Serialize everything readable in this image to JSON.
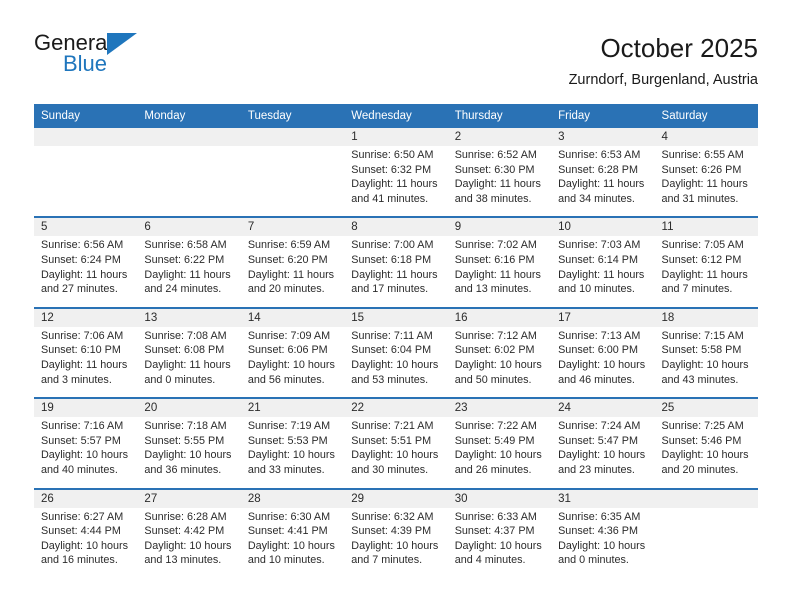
{
  "brand": {
    "name_top": "General",
    "name_bottom": "Blue",
    "accent_color": "#1f76bd"
  },
  "header": {
    "title": "October 2025",
    "subtitle": "Zurndorf, Burgenland, Austria"
  },
  "theme": {
    "header_bar_color": "#2a72b5",
    "daynum_band_color": "#f0f0f0",
    "text_color": "#2b2b2b"
  },
  "weekdays": [
    "Sunday",
    "Monday",
    "Tuesday",
    "Wednesday",
    "Thursday",
    "Friday",
    "Saturday"
  ],
  "weeks": [
    [
      {
        "day": "",
        "sunrise": "",
        "sunset": "",
        "daylight_a": "",
        "daylight_b": ""
      },
      {
        "day": "",
        "sunrise": "",
        "sunset": "",
        "daylight_a": "",
        "daylight_b": ""
      },
      {
        "day": "",
        "sunrise": "",
        "sunset": "",
        "daylight_a": "",
        "daylight_b": ""
      },
      {
        "day": "1",
        "sunrise": "Sunrise: 6:50 AM",
        "sunset": "Sunset: 6:32 PM",
        "daylight_a": "Daylight: 11 hours",
        "daylight_b": "and 41 minutes."
      },
      {
        "day": "2",
        "sunrise": "Sunrise: 6:52 AM",
        "sunset": "Sunset: 6:30 PM",
        "daylight_a": "Daylight: 11 hours",
        "daylight_b": "and 38 minutes."
      },
      {
        "day": "3",
        "sunrise": "Sunrise: 6:53 AM",
        "sunset": "Sunset: 6:28 PM",
        "daylight_a": "Daylight: 11 hours",
        "daylight_b": "and 34 minutes."
      },
      {
        "day": "4",
        "sunrise": "Sunrise: 6:55 AM",
        "sunset": "Sunset: 6:26 PM",
        "daylight_a": "Daylight: 11 hours",
        "daylight_b": "and 31 minutes."
      }
    ],
    [
      {
        "day": "5",
        "sunrise": "Sunrise: 6:56 AM",
        "sunset": "Sunset: 6:24 PM",
        "daylight_a": "Daylight: 11 hours",
        "daylight_b": "and 27 minutes."
      },
      {
        "day": "6",
        "sunrise": "Sunrise: 6:58 AM",
        "sunset": "Sunset: 6:22 PM",
        "daylight_a": "Daylight: 11 hours",
        "daylight_b": "and 24 minutes."
      },
      {
        "day": "7",
        "sunrise": "Sunrise: 6:59 AM",
        "sunset": "Sunset: 6:20 PM",
        "daylight_a": "Daylight: 11 hours",
        "daylight_b": "and 20 minutes."
      },
      {
        "day": "8",
        "sunrise": "Sunrise: 7:00 AM",
        "sunset": "Sunset: 6:18 PM",
        "daylight_a": "Daylight: 11 hours",
        "daylight_b": "and 17 minutes."
      },
      {
        "day": "9",
        "sunrise": "Sunrise: 7:02 AM",
        "sunset": "Sunset: 6:16 PM",
        "daylight_a": "Daylight: 11 hours",
        "daylight_b": "and 13 minutes."
      },
      {
        "day": "10",
        "sunrise": "Sunrise: 7:03 AM",
        "sunset": "Sunset: 6:14 PM",
        "daylight_a": "Daylight: 11 hours",
        "daylight_b": "and 10 minutes."
      },
      {
        "day": "11",
        "sunrise": "Sunrise: 7:05 AM",
        "sunset": "Sunset: 6:12 PM",
        "daylight_a": "Daylight: 11 hours",
        "daylight_b": "and 7 minutes."
      }
    ],
    [
      {
        "day": "12",
        "sunrise": "Sunrise: 7:06 AM",
        "sunset": "Sunset: 6:10 PM",
        "daylight_a": "Daylight: 11 hours",
        "daylight_b": "and 3 minutes."
      },
      {
        "day": "13",
        "sunrise": "Sunrise: 7:08 AM",
        "sunset": "Sunset: 6:08 PM",
        "daylight_a": "Daylight: 11 hours",
        "daylight_b": "and 0 minutes."
      },
      {
        "day": "14",
        "sunrise": "Sunrise: 7:09 AM",
        "sunset": "Sunset: 6:06 PM",
        "daylight_a": "Daylight: 10 hours",
        "daylight_b": "and 56 minutes."
      },
      {
        "day": "15",
        "sunrise": "Sunrise: 7:11 AM",
        "sunset": "Sunset: 6:04 PM",
        "daylight_a": "Daylight: 10 hours",
        "daylight_b": "and 53 minutes."
      },
      {
        "day": "16",
        "sunrise": "Sunrise: 7:12 AM",
        "sunset": "Sunset: 6:02 PM",
        "daylight_a": "Daylight: 10 hours",
        "daylight_b": "and 50 minutes."
      },
      {
        "day": "17",
        "sunrise": "Sunrise: 7:13 AM",
        "sunset": "Sunset: 6:00 PM",
        "daylight_a": "Daylight: 10 hours",
        "daylight_b": "and 46 minutes."
      },
      {
        "day": "18",
        "sunrise": "Sunrise: 7:15 AM",
        "sunset": "Sunset: 5:58 PM",
        "daylight_a": "Daylight: 10 hours",
        "daylight_b": "and 43 minutes."
      }
    ],
    [
      {
        "day": "19",
        "sunrise": "Sunrise: 7:16 AM",
        "sunset": "Sunset: 5:57 PM",
        "daylight_a": "Daylight: 10 hours",
        "daylight_b": "and 40 minutes."
      },
      {
        "day": "20",
        "sunrise": "Sunrise: 7:18 AM",
        "sunset": "Sunset: 5:55 PM",
        "daylight_a": "Daylight: 10 hours",
        "daylight_b": "and 36 minutes."
      },
      {
        "day": "21",
        "sunrise": "Sunrise: 7:19 AM",
        "sunset": "Sunset: 5:53 PM",
        "daylight_a": "Daylight: 10 hours",
        "daylight_b": "and 33 minutes."
      },
      {
        "day": "22",
        "sunrise": "Sunrise: 7:21 AM",
        "sunset": "Sunset: 5:51 PM",
        "daylight_a": "Daylight: 10 hours",
        "daylight_b": "and 30 minutes."
      },
      {
        "day": "23",
        "sunrise": "Sunrise: 7:22 AM",
        "sunset": "Sunset: 5:49 PM",
        "daylight_a": "Daylight: 10 hours",
        "daylight_b": "and 26 minutes."
      },
      {
        "day": "24",
        "sunrise": "Sunrise: 7:24 AM",
        "sunset": "Sunset: 5:47 PM",
        "daylight_a": "Daylight: 10 hours",
        "daylight_b": "and 23 minutes."
      },
      {
        "day": "25",
        "sunrise": "Sunrise: 7:25 AM",
        "sunset": "Sunset: 5:46 PM",
        "daylight_a": "Daylight: 10 hours",
        "daylight_b": "and 20 minutes."
      }
    ],
    [
      {
        "day": "26",
        "sunrise": "Sunrise: 6:27 AM",
        "sunset": "Sunset: 4:44 PM",
        "daylight_a": "Daylight: 10 hours",
        "daylight_b": "and 16 minutes."
      },
      {
        "day": "27",
        "sunrise": "Sunrise: 6:28 AM",
        "sunset": "Sunset: 4:42 PM",
        "daylight_a": "Daylight: 10 hours",
        "daylight_b": "and 13 minutes."
      },
      {
        "day": "28",
        "sunrise": "Sunrise: 6:30 AM",
        "sunset": "Sunset: 4:41 PM",
        "daylight_a": "Daylight: 10 hours",
        "daylight_b": "and 10 minutes."
      },
      {
        "day": "29",
        "sunrise": "Sunrise: 6:32 AM",
        "sunset": "Sunset: 4:39 PM",
        "daylight_a": "Daylight: 10 hours",
        "daylight_b": "and 7 minutes."
      },
      {
        "day": "30",
        "sunrise": "Sunrise: 6:33 AM",
        "sunset": "Sunset: 4:37 PM",
        "daylight_a": "Daylight: 10 hours",
        "daylight_b": "and 4 minutes."
      },
      {
        "day": "31",
        "sunrise": "Sunrise: 6:35 AM",
        "sunset": "Sunset: 4:36 PM",
        "daylight_a": "Daylight: 10 hours",
        "daylight_b": "and 0 minutes."
      },
      {
        "day": "",
        "sunrise": "",
        "sunset": "",
        "daylight_a": "",
        "daylight_b": ""
      }
    ]
  ]
}
